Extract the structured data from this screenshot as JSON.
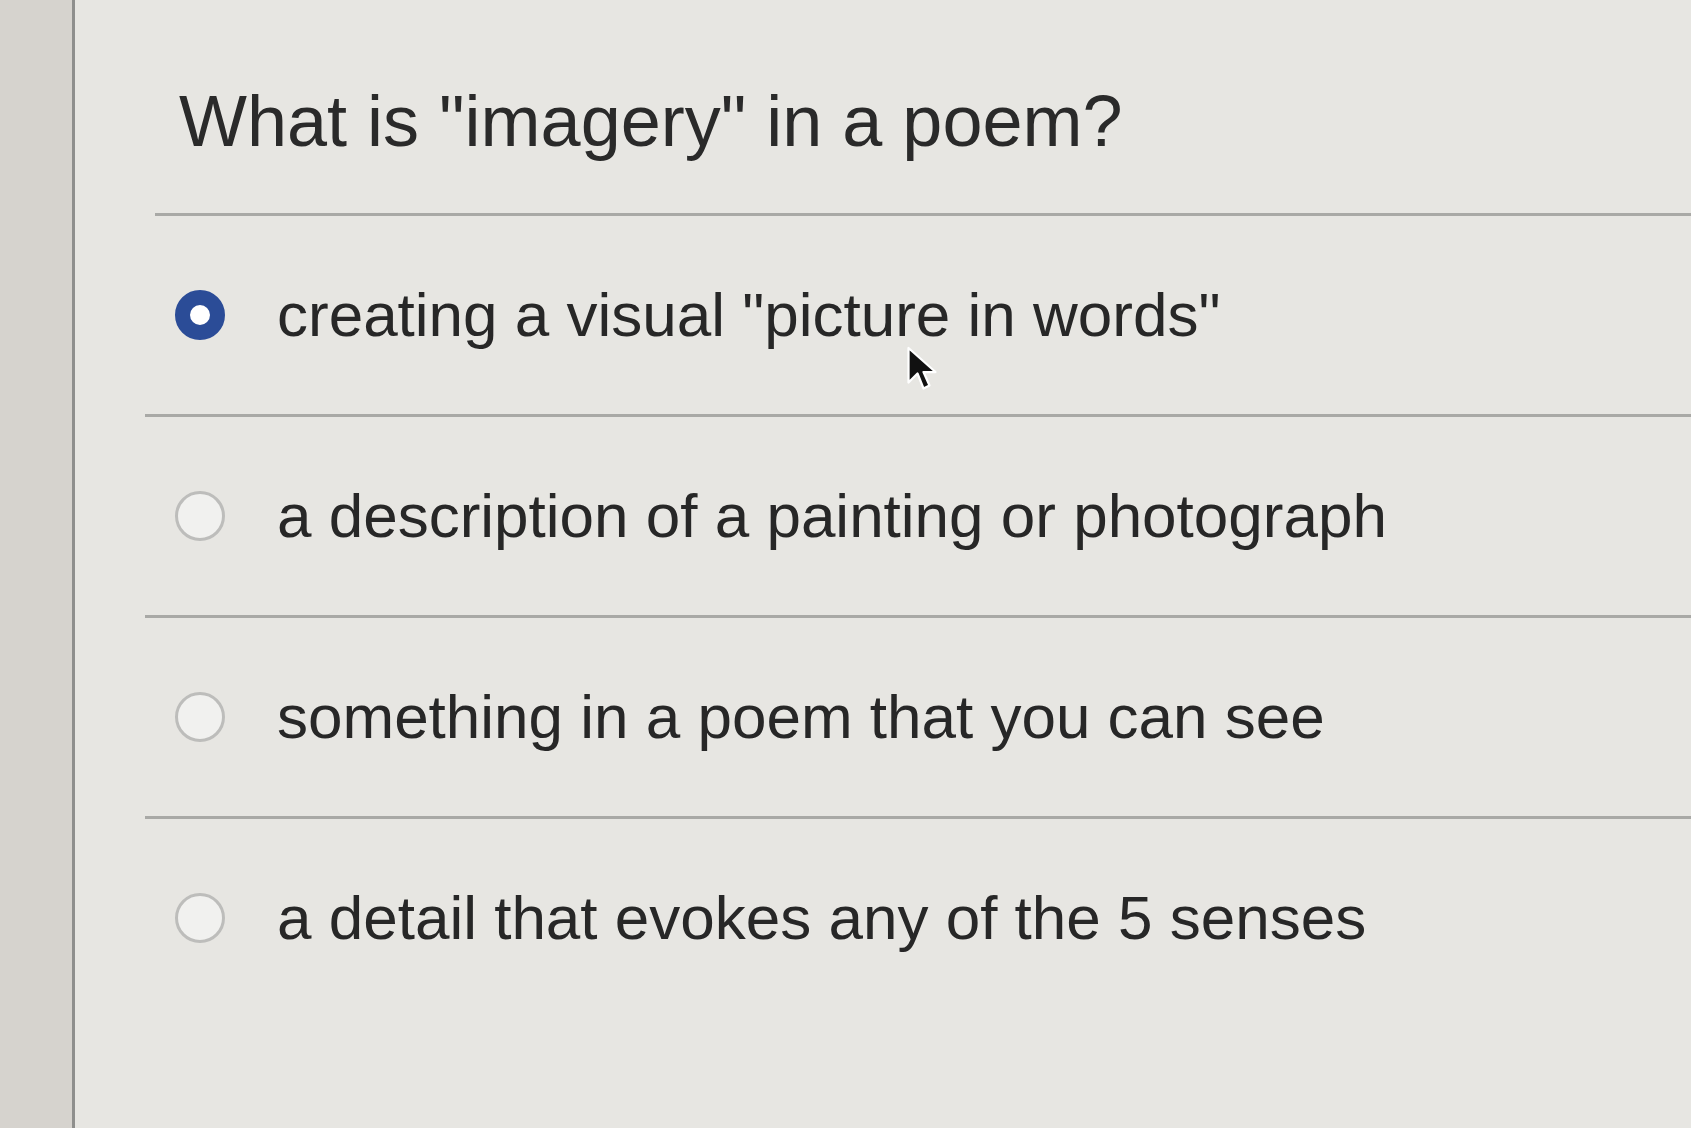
{
  "question": "What is \"imagery\" in a poem?",
  "options": [
    {
      "label": "creating a visual \"picture in words\"",
      "selected": true
    },
    {
      "label": "a description of a painting or photograph",
      "selected": false
    },
    {
      "label": "something in a poem that you can see",
      "selected": false
    },
    {
      "label": "a detail that evokes any of the 5 senses",
      "selected": false
    }
  ]
}
